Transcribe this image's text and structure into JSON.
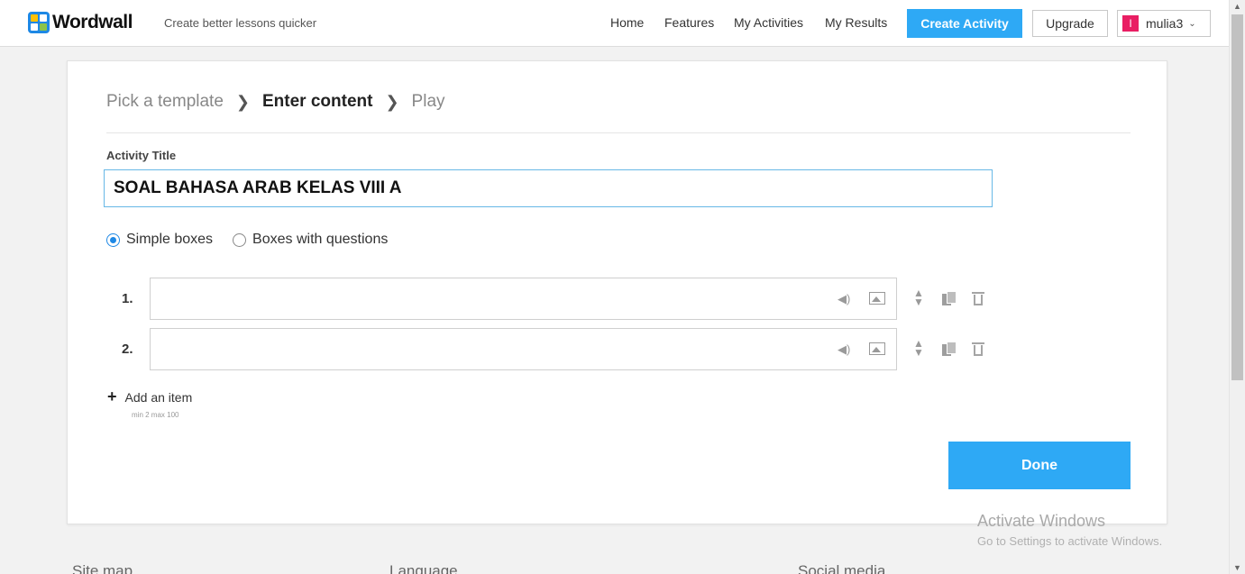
{
  "header": {
    "logo_text": "Wordwall",
    "tagline": "Create better lessons quicker",
    "nav": [
      "Home",
      "Features",
      "My Activities",
      "My Results"
    ],
    "create_button": "Create Activity",
    "upgrade_button": "Upgrade",
    "user": {
      "avatar_letter": "I",
      "name": "mulia3",
      "chevron": "⌄"
    }
  },
  "steps": {
    "items": [
      "Pick a template",
      "Enter content",
      "Play"
    ],
    "active_index": 1,
    "separator": "❯"
  },
  "form": {
    "title_label": "Activity Title",
    "title_value": "SOAL BAHASA ARAB KELAS VIII A",
    "radio_options": [
      {
        "label": "Simple boxes",
        "checked": true
      },
      {
        "label": "Boxes with questions",
        "checked": false
      }
    ],
    "items": [
      {
        "number": "1.",
        "value": ""
      },
      {
        "number": "2.",
        "value": ""
      }
    ],
    "add_item_label": "Add an item",
    "add_item_icon": "+",
    "min_max": "min 2   max 100",
    "done_button": "Done"
  },
  "watermark": {
    "title": "Activate Windows",
    "subtitle": "Go to Settings to activate Windows."
  },
  "footer": {
    "columns": [
      "Site map",
      "Language",
      "Social media"
    ]
  },
  "icons": {
    "sound": "speaker-icon",
    "image": "image-icon",
    "reorder": "reorder-icon",
    "duplicate": "duplicate-icon",
    "delete": "trash-icon"
  },
  "colors": {
    "accent": "#2ea9f5",
    "input_border": "#67b8e6",
    "avatar": "#e91e63"
  }
}
